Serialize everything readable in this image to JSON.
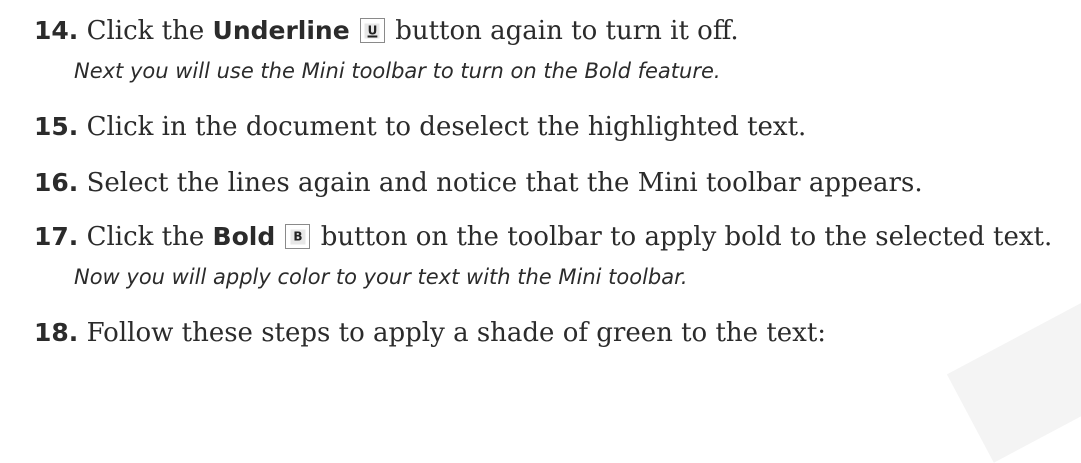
{
  "steps": [
    {
      "number": "14.",
      "before": "Click the ",
      "keyword": "Underline",
      "icon": "underline-icon",
      "icon_glyph": "U",
      "after": " button again to turn it off.",
      "note": "Next you will use the Mini toolbar to turn on the Bold feature."
    },
    {
      "number": "15.",
      "text": "Click in the document to deselect the highlighted text."
    },
    {
      "number": "16.",
      "text": "Select the lines again and notice that the Mini toolbar appears."
    },
    {
      "number": "17.",
      "before": "Click the ",
      "keyword": "Bold",
      "icon": "bold-icon",
      "icon_glyph": "B",
      "after": " button on the toolbar to apply bold to the selected text.",
      "note": "Now you will apply color to your text with the Mini toolbar."
    },
    {
      "number": "18.",
      "text": "Follow these steps to apply a shade of green to the text:"
    }
  ]
}
